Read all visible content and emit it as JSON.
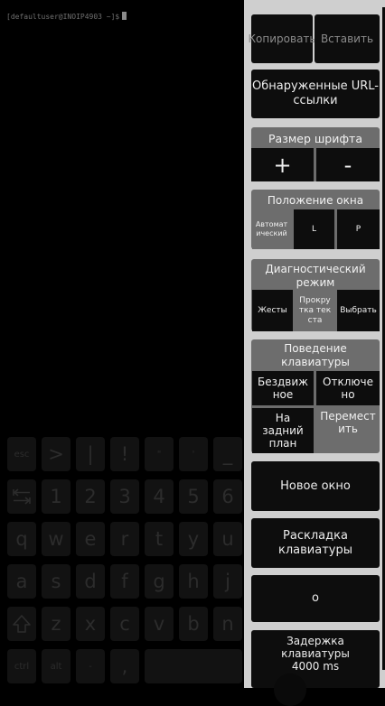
{
  "terminal": {
    "prompt": "[defaultuser@INOIP4903 ~]$"
  },
  "keyboard": {
    "rows": [
      [
        "esc",
        ">",
        "|",
        "!",
        "\"",
        "'",
        "_"
      ],
      [
        "tab",
        "1",
        "2",
        "3",
        "4",
        "5",
        "6"
      ],
      [
        "q",
        "w",
        "e",
        "r",
        "t",
        "y",
        "u"
      ],
      [
        "a",
        "s",
        "d",
        "f",
        "g",
        "h",
        "j"
      ],
      [
        "shift",
        "z",
        "x",
        "c",
        "v",
        "b",
        "n"
      ],
      [
        "ctrl",
        "alt",
        "-",
        ",",
        "",
        "",
        ""
      ]
    ]
  },
  "panel": {
    "copy": "Копировать",
    "paste": "Вставить",
    "urls": "Обнаруженные URL-ссылки",
    "font_size": {
      "title": "Размер шрифта",
      "plus": "+",
      "minus": "-"
    },
    "window_pos": {
      "title": "Положение окна",
      "auto": "Автоматический",
      "left": "L",
      "right": "P"
    },
    "diag": {
      "title": "Диагностический режим",
      "gestures": "Жесты",
      "scroll": "Прокрутка текста",
      "select": "Выбрать"
    },
    "kbd_behavior": {
      "title": "Поведение клавиатуры",
      "fixed": "Бездвижное",
      "off": "Отключено",
      "background": "На задний план",
      "move": "Переместить"
    },
    "new_window": "Новое окно",
    "layout": "Раскладка клавиатуры",
    "o_button": "o",
    "delay": "Задержка клавиатуры 4000 ms"
  }
}
